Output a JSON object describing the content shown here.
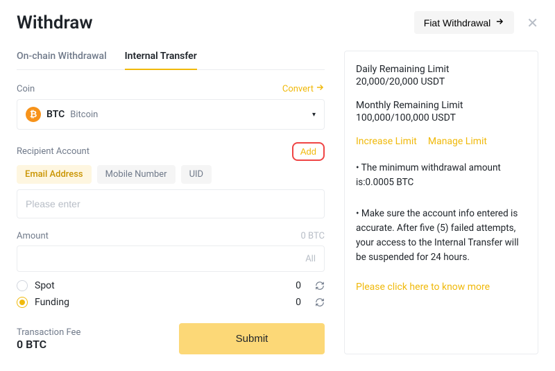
{
  "header": {
    "title": "Withdraw",
    "fiat_label": "Fiat Withdrawal"
  },
  "tabs": {
    "onchain": "On-chain Withdrawal",
    "internal": "Internal Transfer"
  },
  "coin": {
    "label": "Coin",
    "convert": "Convert",
    "symbol": "BTC",
    "name": "Bitcoin",
    "icon_glyph": "₿"
  },
  "recipient": {
    "label": "Recipient Account",
    "add_label": "Add",
    "types": {
      "email": "Email Address",
      "mobile": "Mobile Number",
      "uid": "UID"
    },
    "placeholder": "Please enter"
  },
  "amount": {
    "label": "Amount",
    "balance_hint": "0 BTC",
    "all_label": "All"
  },
  "wallets": {
    "spot": {
      "name": "Spot",
      "balance": "0"
    },
    "funding": {
      "name": "Funding",
      "balance": "0"
    }
  },
  "fee": {
    "label": "Transaction Fee",
    "value": "0 BTC"
  },
  "submit_label": "Submit",
  "side": {
    "daily_label": "Daily Remaining Limit",
    "daily_value": "20,000/20,000 USDT",
    "monthly_label": "Monthly Remaining Limit",
    "monthly_value": "100,000/100,000 USDT",
    "increase": "Increase Limit",
    "manage": "Manage Limit",
    "min_note": "• The minimum withdrawal amount is:0.0005 BTC",
    "accuracy_note": "• Make sure the account info entered is accurate. After five (5) failed attempts, your access to the Internal Transfer will be suspended for 24 hours.",
    "know_more": "Please click here to know more"
  }
}
